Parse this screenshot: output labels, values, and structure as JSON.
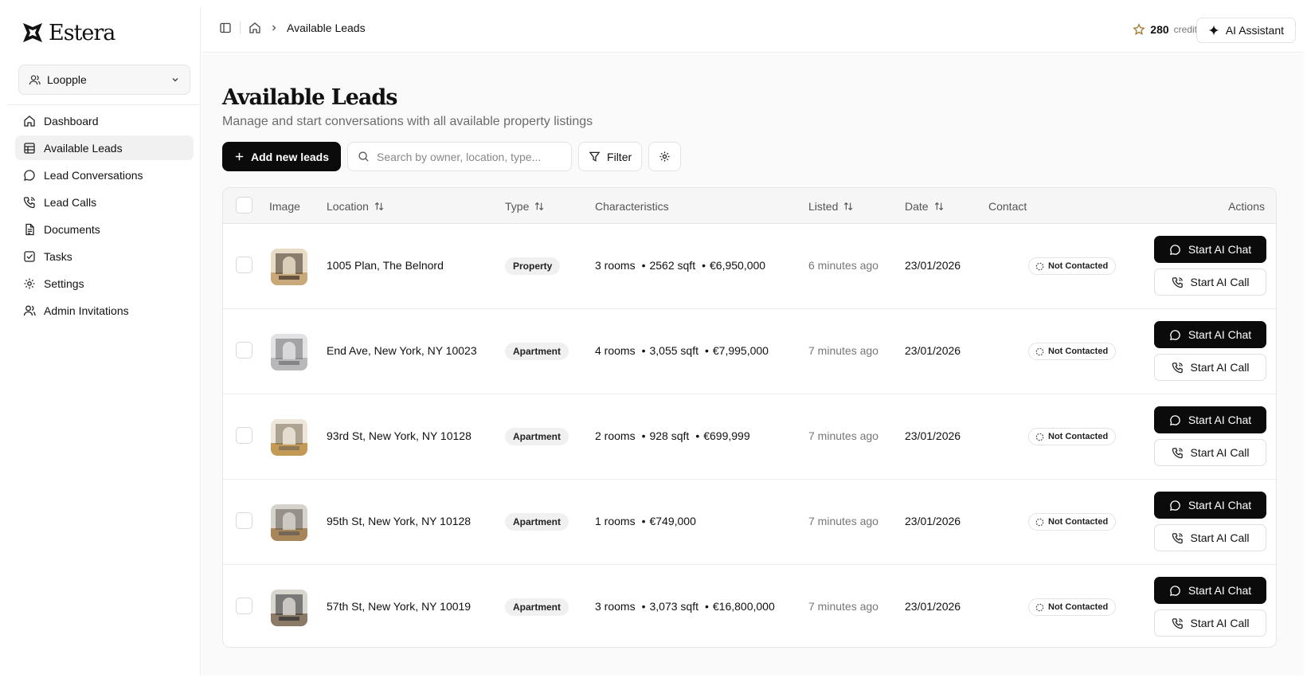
{
  "brand": {
    "name": "Estera"
  },
  "workspace": {
    "name": "Loopple"
  },
  "sidebar": {
    "items": [
      {
        "label": "Dashboard",
        "icon": "home-icon"
      },
      {
        "label": "Available Leads",
        "icon": "table-icon",
        "active": true
      },
      {
        "label": "Lead Conversations",
        "icon": "chat-bubble-icon"
      },
      {
        "label": "Lead Calls",
        "icon": "phone-icon"
      },
      {
        "label": "Documents",
        "icon": "document-icon"
      },
      {
        "label": "Tasks",
        "icon": "checkbox-icon"
      },
      {
        "label": "Settings",
        "icon": "gear-icon"
      },
      {
        "label": "Admin Invitations",
        "icon": "users-icon"
      }
    ]
  },
  "header": {
    "breadcrumb_current": "Available Leads",
    "credits_value": "280",
    "credits_label": "credits",
    "ai_assistant_label": "AI Assistant"
  },
  "page": {
    "title": "Available Leads",
    "subtitle": "Manage and start conversations with all available property listings"
  },
  "toolbar": {
    "add_label": "Add new leads",
    "search_placeholder": "Search by owner, location, type...",
    "filter_label": "Filter"
  },
  "table": {
    "columns": {
      "image": "Image",
      "location": "Location",
      "type": "Type",
      "characteristics": "Characteristics",
      "listed": "Listed",
      "date": "Date",
      "contact": "Contact",
      "actions": "Actions"
    },
    "chat_label": "Start AI Chat",
    "call_label": "Start AI Call",
    "rows": [
      {
        "location": "1005 Plan, The Belnord",
        "type": "Property",
        "rooms": "3 rooms",
        "sqft": "2562 sqft",
        "price": "€6,950,000",
        "listed": "6 minutes ago",
        "date": "23/01/2026",
        "contact": "Not Contacted"
      },
      {
        "location": "End Ave, New York, NY 10023",
        "type": "Apartment",
        "rooms": "4 rooms",
        "sqft": "3,055 sqft",
        "price": "€7,995,000",
        "listed": "7 minutes ago",
        "date": "23/01/2026",
        "contact": "Not Contacted"
      },
      {
        "location": "93rd St, New York, NY 10128",
        "type": "Apartment",
        "rooms": "2 rooms",
        "sqft": "928 sqft",
        "price": "€699,999",
        "listed": "7 minutes ago",
        "date": "23/01/2026",
        "contact": "Not Contacted"
      },
      {
        "location": "95th St, New York, NY 10128",
        "type": "Apartment",
        "rooms": "1 rooms",
        "sqft": "",
        "price": "€749,000",
        "listed": "7 minutes ago",
        "date": "23/01/2026",
        "contact": "Not Contacted"
      },
      {
        "location": "57th St, New York, NY 10019",
        "type": "Apartment",
        "rooms": "3 rooms",
        "sqft": "3,073 sqft",
        "price": "€16,800,000",
        "listed": "7 minutes ago",
        "date": "23/01/2026",
        "contact": "Not Contacted"
      }
    ]
  },
  "colors": {
    "primary": "#0b0b0b",
    "muted_text": "#6b6b6b",
    "border": "#e6e6e6",
    "header_bg": "#f6f6f6",
    "star": "#a0782a"
  }
}
